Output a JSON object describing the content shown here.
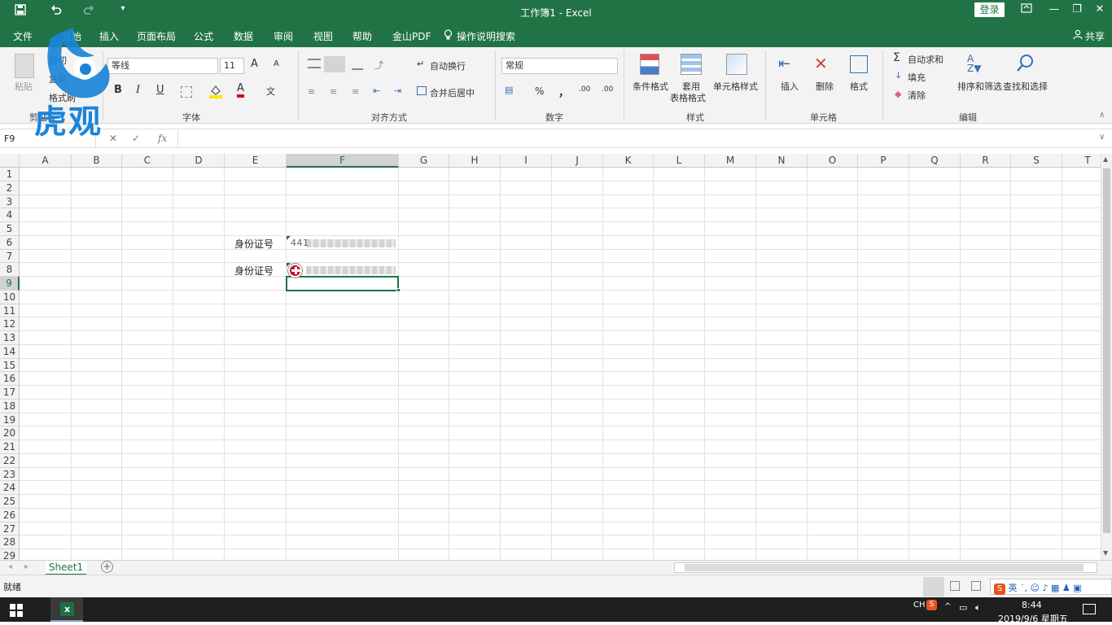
{
  "titlebar": {
    "title": "工作簿1  -  Excel",
    "login_label": "登录",
    "icons": [
      "save-icon",
      "undo-icon",
      "redo-icon",
      "customize-icon"
    ]
  },
  "menu": {
    "items": [
      "文件",
      "开始",
      "插入",
      "页面布局",
      "公式",
      "数据",
      "审阅",
      "视图",
      "帮助",
      "金山PDF"
    ],
    "tell_me": "操作说明搜索",
    "share": "共享"
  },
  "ribbon": {
    "clipboard": {
      "paste": "粘贴",
      "cut": "剪切",
      "copy": "复制",
      "painter": "格式刷",
      "label": "剪贴板"
    },
    "font": {
      "name": "等线",
      "size": "11",
      "label": "字体",
      "bold": "B",
      "italic": "I",
      "underline": "U",
      "grow": "A",
      "shrink": "A",
      "font_color": "A",
      "phonetic": "文"
    },
    "alignment": {
      "wrap": "自动换行",
      "merge": "合并后居中",
      "label": "对齐方式"
    },
    "number": {
      "format": "常规",
      "percent": "%",
      "comma": "，",
      "inc_dec": ".00",
      "dec_dec": ".00",
      "label": "数字"
    },
    "styles": {
      "conditional": "条件格式",
      "table_line1": "套用",
      "table_line2": "表格格式",
      "cell_styles": "单元格样式",
      "label": "样式"
    },
    "cells": {
      "insert": "插入",
      "delete": "删除",
      "format": "格式",
      "label": "单元格"
    },
    "editing": {
      "autosum": "自动求和",
      "fill": "填充",
      "clear": "清除",
      "sort": "排序和筛选",
      "find": "查找和选择",
      "label": "编辑"
    }
  },
  "formula_bar": {
    "name_box": "F9",
    "cancel": "✕",
    "enter": "✓",
    "fx": "fx",
    "value": ""
  },
  "grid": {
    "columns": [
      "A",
      "B",
      "C",
      "D",
      "E",
      "F",
      "G",
      "H",
      "I",
      "J",
      "K",
      "L",
      "M",
      "N",
      "O",
      "P",
      "Q",
      "R",
      "S",
      "T"
    ],
    "rows": [
      "1",
      "2",
      "3",
      "4",
      "5",
      "6",
      "7",
      "8",
      "9",
      "10",
      "11",
      "12",
      "13",
      "14",
      "15",
      "16",
      "17",
      "18",
      "19",
      "20",
      "21",
      "22",
      "23",
      "24",
      "25",
      "26",
      "27",
      "28",
      "29"
    ],
    "selected_column": "F",
    "selected_row": "9",
    "cells": [
      {
        "ref": "E6",
        "text": "身份证号"
      },
      {
        "ref": "F6",
        "text": "441"
      },
      {
        "ref": "E8",
        "text": "身份证号"
      },
      {
        "ref": "F8",
        "text": "1"
      }
    ]
  },
  "sheets": {
    "tabs": [
      "Sheet1"
    ],
    "add": "+"
  },
  "status": {
    "ready": "就绪"
  },
  "taskbar": {
    "ime": "CH",
    "ime_mode": "英",
    "time": "8:44",
    "date": "2019/9/6 星期五"
  },
  "watermark": {
    "text": "虎观"
  }
}
